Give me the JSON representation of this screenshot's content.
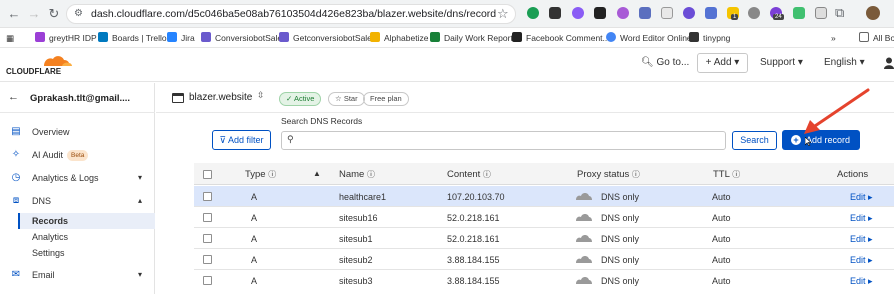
{
  "browser": {
    "url": "dash.cloudflare.com/d5c046ba5e08ab76103504d426e823ba/blazer.website/dns/records?recordsSearchS...",
    "bookmarks": [
      "greytHR IDP",
      "Boards | Trello",
      "Jira",
      "ConversiobotSale",
      "GetconversiobotSale",
      "Alphabetize",
      "Daily Work Report",
      "Facebook Comment...",
      "Word Editor Online",
      "tinypng"
    ],
    "all_bookmarks": "All Bo",
    "ext_badge": "24",
    "ext_badge2": "1"
  },
  "header": {
    "logo": "CLOUDFLARE",
    "goto": "Go to...",
    "add": "+ Add",
    "support": "Support",
    "language": "English"
  },
  "sidebar": {
    "account": "Gprakash.tlt@gmail....",
    "items": [
      {
        "label": "Overview",
        "icon": "document-icon"
      },
      {
        "label": "AI Audit",
        "icon": "ai-icon",
        "badge": "Beta"
      },
      {
        "label": "Analytics & Logs",
        "icon": "clock-icon"
      },
      {
        "label": "DNS",
        "icon": "network-icon"
      },
      {
        "label": "Email",
        "icon": "mail-icon"
      }
    ],
    "dns_sub": [
      "Records",
      "Analytics",
      "Settings"
    ]
  },
  "zone": {
    "name": "blazer.website",
    "status": "Active",
    "star": "Star",
    "plan": "Free plan"
  },
  "toolbar": {
    "add_filter": "Add filter",
    "search_label": "Search DNS Records",
    "search_placeholder": "",
    "search_button": "Search",
    "add_record": "Add record"
  },
  "table": {
    "headers": [
      "Type",
      "Name",
      "Content",
      "Proxy status",
      "TTL",
      "Actions"
    ],
    "rows": [
      {
        "type": "A",
        "name": "healthcare1",
        "content": "107.20.103.70",
        "proxy": "DNS only",
        "ttl": "Auto",
        "action": "Edit"
      },
      {
        "type": "A",
        "name": "sitesub16",
        "content": "52.0.218.161",
        "proxy": "DNS only",
        "ttl": "Auto",
        "action": "Edit"
      },
      {
        "type": "A",
        "name": "sitesub1",
        "content": "52.0.218.161",
        "proxy": "DNS only",
        "ttl": "Auto",
        "action": "Edit"
      },
      {
        "type": "A",
        "name": "sitesub2",
        "content": "3.88.184.155",
        "proxy": "DNS only",
        "ttl": "Auto",
        "action": "Edit"
      },
      {
        "type": "A",
        "name": "sitesub3",
        "content": "3.88.184.155",
        "proxy": "DNS only",
        "ttl": "Auto",
        "action": "Edit"
      }
    ],
    "selected_row": 0
  },
  "colors": {
    "accent": "#0051c3",
    "cf_orange": "#f48120",
    "active_green": "#1e7e34",
    "arrow_red": "#e5432d"
  }
}
